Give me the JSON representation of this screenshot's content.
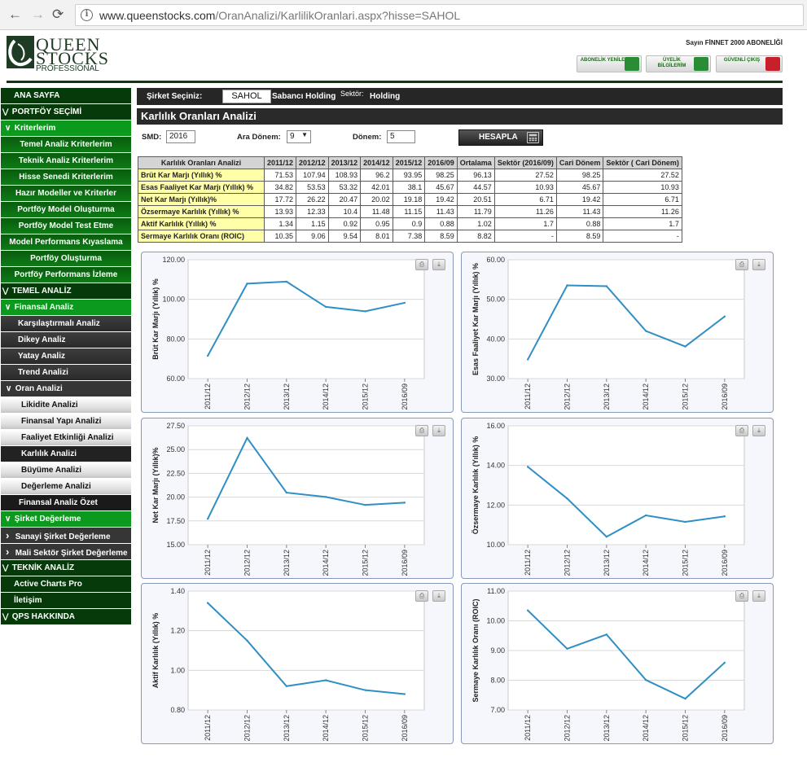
{
  "browser": {
    "url_host": "www.queenstocks.com",
    "url_path": "/OranAnalizi/KarlilikOranlari.aspx?hisse=SAHOL",
    "back": "←",
    "forward": "→",
    "reload": "⟳",
    "info": "i"
  },
  "logo": {
    "line1": "QUEEN",
    "line2": "STOCKS",
    "line3": "PROFESSIONAL"
  },
  "header": {
    "welcome": "Sayın FİNNET 2000 ABONELİĞİ",
    "buttons": [
      {
        "label": "ABONELİK YENİLE",
        "color": "#2b8c36"
      },
      {
        "label": "ÜYELİK BİLGİLERİM",
        "color": "#2b8c36"
      },
      {
        "label": "GÜVENLİ ÇIKIŞ",
        "color": "#c8202b"
      }
    ]
  },
  "sidebar": [
    {
      "label": "ANA SAYFA",
      "style": "l0"
    },
    {
      "label": "PORTFÖY SEÇİMİ",
      "style": "sec",
      "icon": "double-chevron"
    },
    {
      "label": "Kriterlerim",
      "style": "l1",
      "icon": "chevron-down"
    },
    {
      "label": "Temel Analiz Kriterlerim",
      "style": "l2"
    },
    {
      "label": "Teknik Analiz Kriterlerim",
      "style": "l2"
    },
    {
      "label": "Hisse Senedi Kriterlerim",
      "style": "l2"
    },
    {
      "label": "Hazır Modeller ve Kriterler",
      "style": "l2"
    },
    {
      "label": "Portföy Model Oluşturma",
      "style": "l2"
    },
    {
      "label": "Portföy Model Test Etme",
      "style": "l2"
    },
    {
      "label": "Model Performans Kıyaslama",
      "style": "l2"
    },
    {
      "label": "Portföy Oluşturma",
      "style": "l2"
    },
    {
      "label": "Portföy Performans İzleme",
      "style": "l2"
    },
    {
      "label": "TEMEL ANALİZ",
      "style": "sec",
      "icon": "double-chevron"
    },
    {
      "label": "Finansal Analiz",
      "style": "l1",
      "icon": "chevron-down"
    },
    {
      "label": "Karşılaştırmalı Analiz",
      "style": "d2"
    },
    {
      "label": "Dikey Analiz",
      "style": "d2"
    },
    {
      "label": "Yatay Analiz",
      "style": "d2"
    },
    {
      "label": "Trend Analizi",
      "style": "d2"
    },
    {
      "label": "Oran Analizi",
      "style": "d3",
      "icon": "chevron-down"
    },
    {
      "label": "Likidite Analizi",
      "style": "w"
    },
    {
      "label": "Finansal Yapı Analizi",
      "style": "w"
    },
    {
      "label": "Faaliyet Etkinliği Analizi",
      "style": "w"
    },
    {
      "label": "Karlılık Analizi",
      "style": "act"
    },
    {
      "label": "Büyüme Analizi",
      "style": "w"
    },
    {
      "label": "Değerleme Analizi",
      "style": "w"
    },
    {
      "label": "Finansal Analiz Özet",
      "style": "dg"
    },
    {
      "label": "Şirket Değerleme",
      "style": "bg",
      "icon": "chevron-down"
    },
    {
      "label": "Sanayi Şirket Değerleme",
      "style": "d3",
      "icon": "chevron-right"
    },
    {
      "label": "Mali Sektör Şirket Değerleme",
      "style": "d3",
      "icon": "chevron-right"
    },
    {
      "label": "TEKNİK ANALİZ",
      "style": "sec",
      "icon": "double-chevron"
    },
    {
      "label": "Active Charts Pro",
      "style": "l0"
    },
    {
      "label": "İletişim",
      "style": "l0"
    },
    {
      "label": "QPS HAKKINDA",
      "style": "sec",
      "icon": "double-chevron"
    }
  ],
  "company": {
    "select_label": "Şirket Seçiniz:",
    "ticker": "SAHOL",
    "name": "Sabancı Holding",
    "sector_label": "Sektör:",
    "sector": "Holding"
  },
  "page_title": "Karlılık Oranları Analizi",
  "form": {
    "smd_label": "SMD:",
    "smd_value": "2016",
    "ara_label": "Ara Dönem:",
    "ara_value": "9",
    "donem_label": "Dönem:",
    "donem_value": "5",
    "button": "HESAPLA"
  },
  "table": {
    "headers": [
      "Karlılık Oranları Analizi",
      "2011/12",
      "2012/12",
      "2013/12",
      "2014/12",
      "2015/12",
      "2016/09",
      "Ortalama",
      "Sektör (2016/09)",
      "Cari Dönem",
      "Sektör ( Cari Dönem)"
    ],
    "rows": [
      [
        "Brüt Kar Marjı (Yıllık) %",
        "71.53",
        "107.94",
        "108.93",
        "96.2",
        "93.95",
        "98.25",
        "96.13",
        "27.52",
        "98.25",
        "27.52"
      ],
      [
        "Esas Faaliyet Kar Marjı (Yıllık) %",
        "34.82",
        "53.53",
        "53.32",
        "42.01",
        "38.1",
        "45.67",
        "44.57",
        "10.93",
        "45.67",
        "10.93"
      ],
      [
        "Net Kar Marjı (Yıllık)%",
        "17.72",
        "26.22",
        "20.47",
        "20.02",
        "19.18",
        "19.42",
        "20.51",
        "6.71",
        "19.42",
        "6.71"
      ],
      [
        "Özsermaye Karlılık (Yıllık) %",
        "13.93",
        "12.33",
        "10.4",
        "11.48",
        "11.15",
        "11.43",
        "11.79",
        "11.26",
        "11.43",
        "11.26"
      ],
      [
        "Aktif Karlılık (Yıllık) %",
        "1.34",
        "1.15",
        "0.92",
        "0.95",
        "0.9",
        "0.88",
        "1.02",
        "1.7",
        "0.88",
        "1.7"
      ],
      [
        "Sermaye Karlılık Oranı (ROIC)",
        "10.35",
        "9.06",
        "9.54",
        "8.01",
        "7.38",
        "8.59",
        "8.82",
        "-",
        "8.59",
        "-"
      ]
    ]
  },
  "chart_data": [
    {
      "type": "line",
      "x": [
        "2011/12",
        "2012/12",
        "2013/12",
        "2014/12",
        "2015/12",
        "2016/09"
      ],
      "values": [
        71.53,
        107.94,
        108.93,
        96.2,
        93.95,
        98.25
      ],
      "ylabel": "Brüt Kar Marjı (Yıllık) %",
      "ylim": [
        60,
        120
      ],
      "ticks": [
        "60.00",
        "80.00",
        "100.00",
        "120.00"
      ],
      "color": "#2f8fc4"
    },
    {
      "type": "line",
      "x": [
        "2011/12",
        "2012/12",
        "2013/12",
        "2014/12",
        "2015/12",
        "2016/09"
      ],
      "values": [
        34.82,
        53.53,
        53.32,
        42.01,
        38.1,
        45.67
      ],
      "ylabel": "Esas Faaliyet Kar Marjı (Yıllık) %",
      "ylim": [
        30,
        60
      ],
      "ticks": [
        "30.00",
        "40.00",
        "50.00",
        "60.00"
      ],
      "color": "#2f8fc4"
    },
    {
      "type": "line",
      "x": [
        "2011/12",
        "2012/12",
        "2013/12",
        "2014/12",
        "2015/12",
        "2016/09"
      ],
      "values": [
        17.72,
        26.22,
        20.47,
        20.02,
        19.18,
        19.42
      ],
      "ylabel": "Net Kar Marjı (Yıllık)%",
      "ylim": [
        15,
        27.5
      ],
      "ticks": [
        "15.00",
        "17.50",
        "20.00",
        "22.50",
        "25.00",
        "27.50"
      ],
      "color": "#2f8fc4"
    },
    {
      "type": "line",
      "x": [
        "2011/12",
        "2012/12",
        "2013/12",
        "2014/12",
        "2015/12",
        "2016/09"
      ],
      "values": [
        13.93,
        12.33,
        10.4,
        11.48,
        11.15,
        11.43
      ],
      "ylabel": "Özsermaye Karlılık (Yıllık) %",
      "ylim": [
        10,
        16
      ],
      "ticks": [
        "10.00",
        "12.00",
        "14.00",
        "16.00"
      ],
      "color": "#2f8fc4"
    },
    {
      "type": "line",
      "x": [
        "2011/12",
        "2012/12",
        "2013/12",
        "2014/12",
        "2015/12",
        "2016/09"
      ],
      "values": [
        1.34,
        1.15,
        0.92,
        0.95,
        0.9,
        0.88
      ],
      "ylabel": "Aktif Karlılık (Yıllık) %",
      "ylim": [
        0.8,
        1.4
      ],
      "ticks": [
        "0.80",
        "1.00",
        "1.20",
        "1.40"
      ],
      "color": "#2f8fc4"
    },
    {
      "type": "line",
      "x": [
        "2011/12",
        "2012/12",
        "2013/12",
        "2014/12",
        "2015/12",
        "2016/09"
      ],
      "values": [
        10.35,
        9.06,
        9.54,
        8.01,
        7.38,
        8.59
      ],
      "ylabel": "Sermaye Karlılık Oranı (ROIC)",
      "ylim": [
        7,
        11
      ],
      "ticks": [
        "7.00",
        "8.00",
        "9.00",
        "10.00",
        "11.00"
      ],
      "color": "#2f8fc4"
    }
  ],
  "chart_tools": {
    "print": "⎙",
    "download": "⤓"
  }
}
